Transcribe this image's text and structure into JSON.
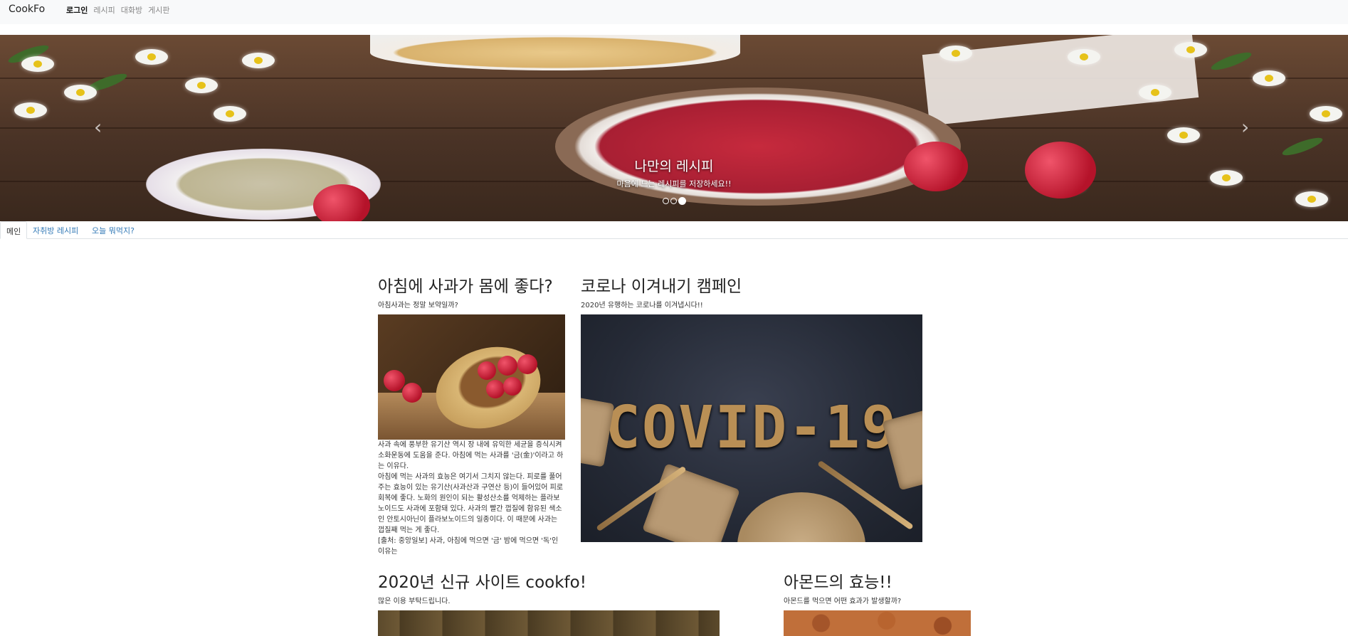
{
  "navbar": {
    "brand": "CookFo",
    "links": [
      "로그인",
      "레시피",
      "대화방",
      "게시판"
    ],
    "active_index": 0
  },
  "hero": {
    "title": "나만의 레시피",
    "subtitle": "마음에 드는 레시피를 저장하세요!!",
    "prev_icon": "chevron-left-icon",
    "next_icon": "chevron-right-icon",
    "slide_count": 3,
    "active_slide": 3
  },
  "tabs": [
    "메인",
    "자취방 레시피",
    "오늘 뭐먹지?"
  ],
  "cards": {
    "apple": {
      "title": "아침에 사과가 몸에 좋다?",
      "subtitle": "아침사과는 정말 보약일까?",
      "body": "사과 속에 풍부한 유기산 역시 장 내에 유익한 세균을 증식시켜 소화운동에 도움을 준다. 아침에 먹는 사과를 '금(金)'이라고 하는 이유다.\n아침에 먹는 사과의 효능은 여기서 그치지 않는다. 피로를 풀어주는 효능이 있는 유기산(사과산과 구연산 등)이 들어있어 피로회복에 좋다. 노화의 원인이 되는 활성산소를 억제하는 플라보노이드도 사과에 포함돼 있다. 사과의 빨간 껍질에 함유된 색소인 안토시아닌이 플라보노이드의 일종이다. 이 때문에 사과는 껍질째 먹는 게 좋다.\n[출처: 중앙일보] 사과, 아침에 먹으면 '금' 밤에 먹으면 '독'인 이유는"
    },
    "covid": {
      "title": "코로나 이겨내기 캠페인",
      "subtitle": "2020년 유행하는 코로나를 이겨냅시다!!",
      "image_text": "COVID-19"
    },
    "site": {
      "title": "2020년 신규 사이트 cookfo!",
      "subtitle": "많은 이용 부탁드립니다."
    },
    "almond": {
      "title": "아몬드의 효능!!",
      "subtitle": "아몬드를 먹으면 어떤 효과가 발생할까?"
    }
  }
}
